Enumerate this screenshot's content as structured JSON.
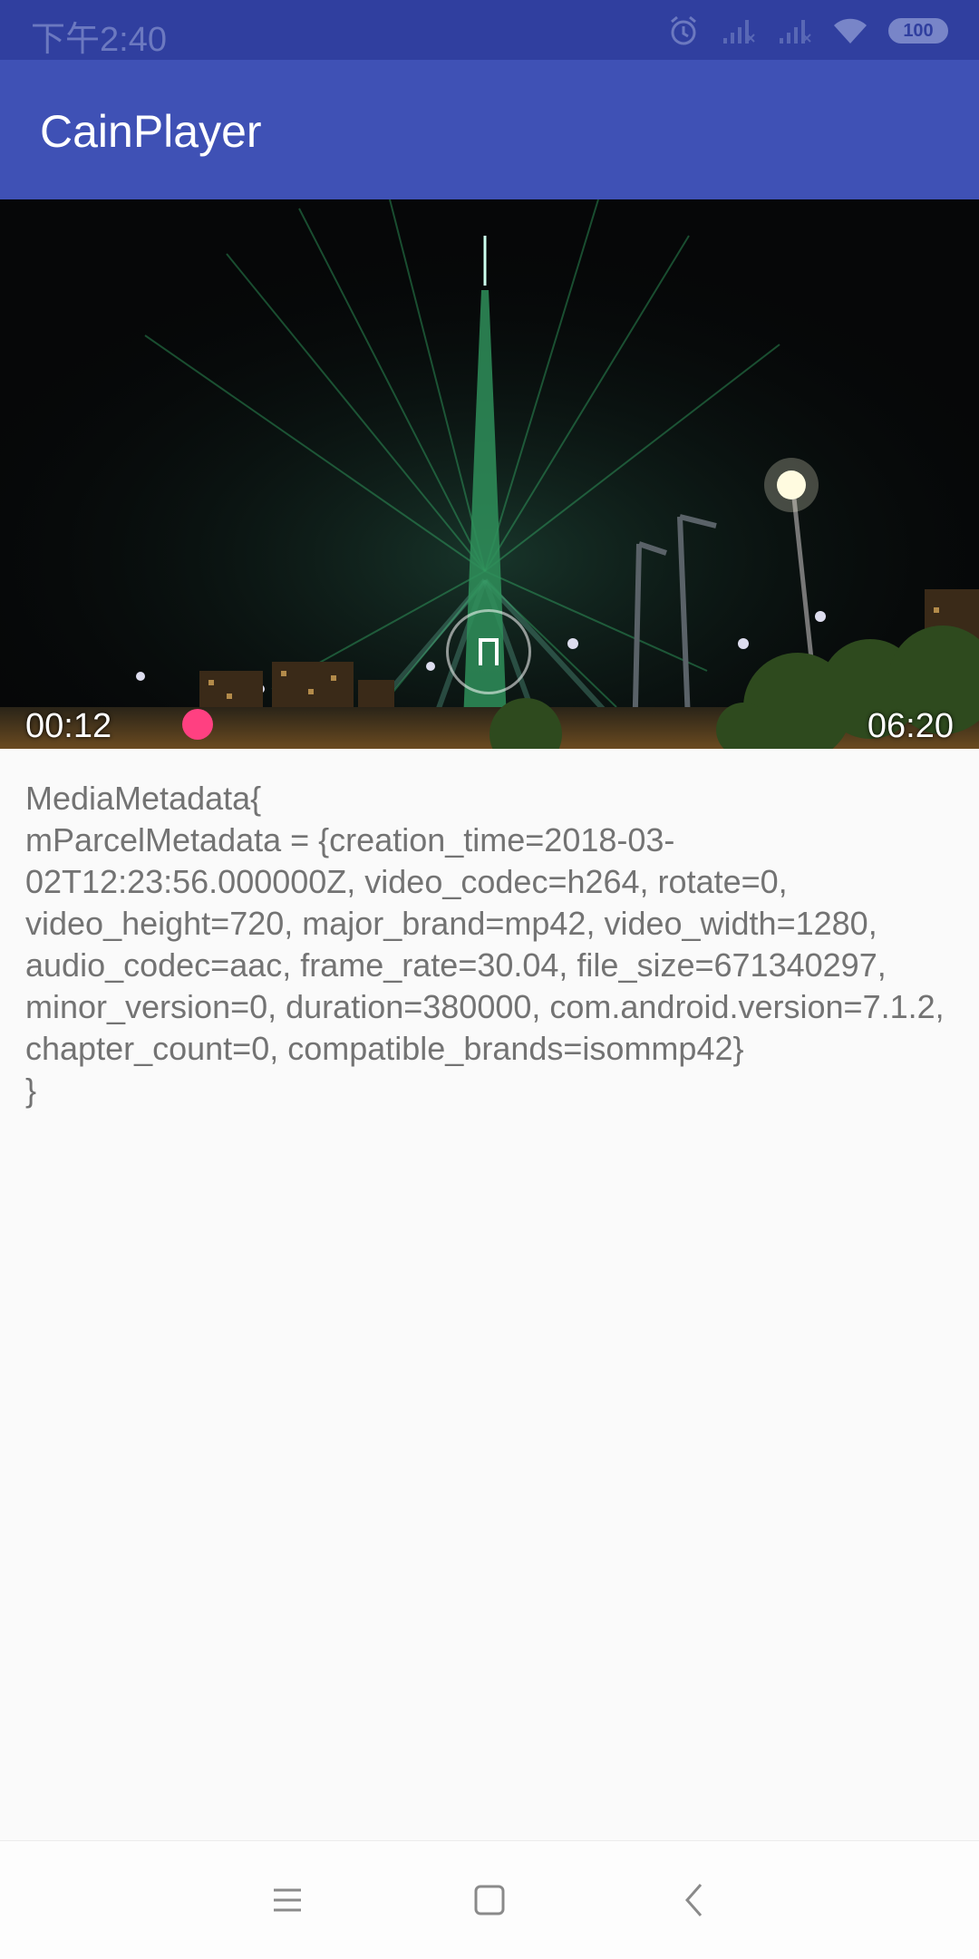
{
  "status_bar": {
    "time": "下午2:40",
    "battery": "100",
    "icons": [
      "alarm-icon",
      "signal-icon",
      "signal-icon",
      "wifi-icon",
      "battery-icon"
    ]
  },
  "app_bar": {
    "title": "CainPlayer",
    "color": "#3f51b5"
  },
  "player": {
    "current_time": "00:12",
    "total_time": "06:20",
    "progress_fraction": 0.031,
    "state": "playing",
    "accent_color": "#ff4081"
  },
  "metadata_text": "MediaMetadata{\nmParcelMetadata = {creation_time=2018-03-02T12:23:56.000000Z, video_codec=h264, rotate=0, video_height=720, major_brand=mp42, video_width=1280, audio_codec=aac, frame_rate=30.04, file_size=671340297, minor_version=0, duration=380000, com.android.version=7.1.2, chapter_count=0, compatible_brands=isommp42}\n}",
  "nav_bar": {
    "buttons": [
      "menu-icon",
      "home-icon",
      "back-icon"
    ]
  }
}
